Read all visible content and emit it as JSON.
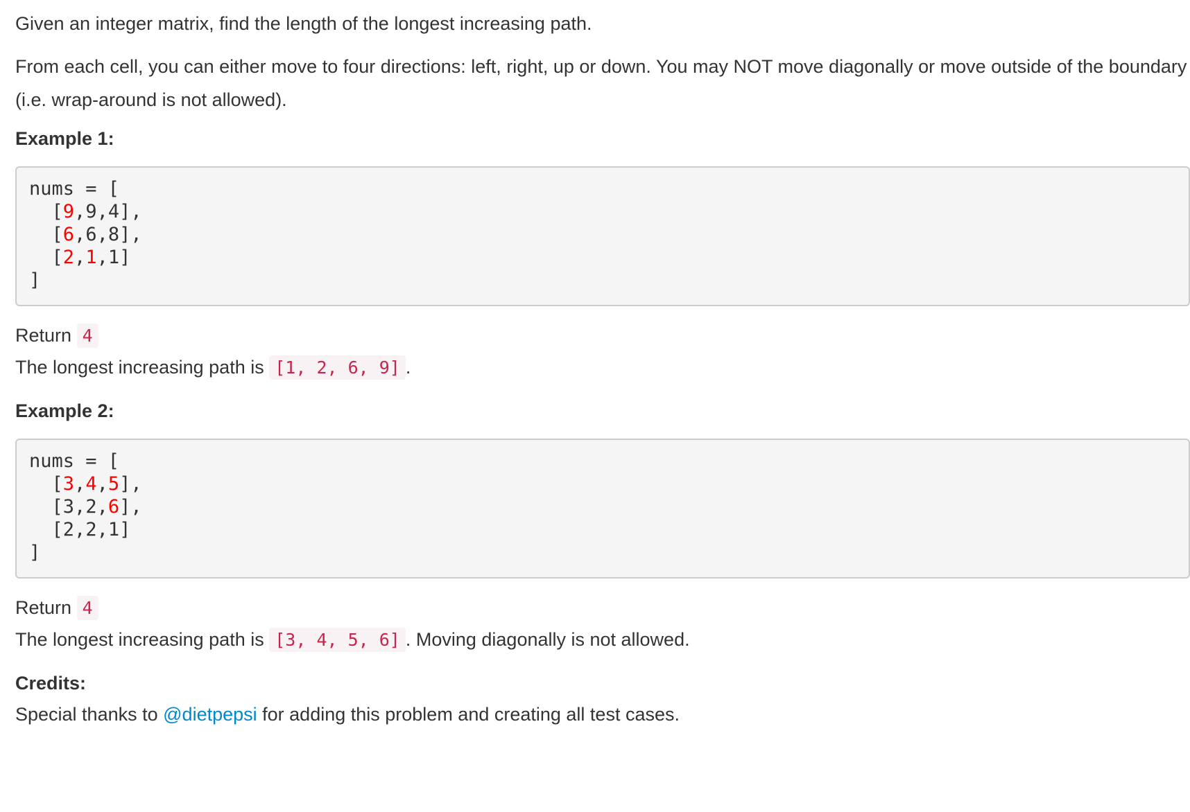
{
  "intro": "Given an integer matrix, find the length of the longest increasing path.",
  "moves": "From each cell, you can either move to four directions: left, right, up or down. You may NOT move diagonally or move outside of the boundary (i.e. wrap-around is not allowed).",
  "example1": {
    "heading": "Example 1:",
    "code": {
      "open": "nums = [",
      "rows": [
        [
          "9",
          "9",
          "4"
        ],
        [
          "6",
          "6",
          "8"
        ],
        [
          "2",
          "1",
          "1"
        ]
      ],
      "close": "]"
    },
    "return_label": "Return",
    "return_value": "4",
    "path_label": "The longest increasing path is",
    "path_value": "[1, 2, 6, 9]",
    "path_suffix": "."
  },
  "example2": {
    "heading": "Example 2:",
    "code": {
      "open": "nums = [",
      "rows": [
        [
          "3",
          "4",
          "5"
        ],
        [
          "3",
          "2",
          "6"
        ],
        [
          "2",
          "2",
          "1"
        ]
      ],
      "close": "]"
    },
    "return_label": "Return",
    "return_value": "4",
    "path_label": "The longest increasing path is",
    "path_value": "[3, 4, 5, 6]",
    "path_suffix": ". Moving diagonally is not allowed."
  },
  "credits": {
    "heading": "Credits:",
    "prefix": "Special thanks to",
    "link_text": "@dietpepsi",
    "suffix": "for adding this problem and creating all test cases."
  },
  "colors": {
    "text": "#333333",
    "highlight": "#ff0000",
    "inline_code": "#c7254e",
    "inline_code_bg": "#f9f2f4",
    "link": "#0088cc",
    "code_block_bg": "#f5f5f5"
  }
}
